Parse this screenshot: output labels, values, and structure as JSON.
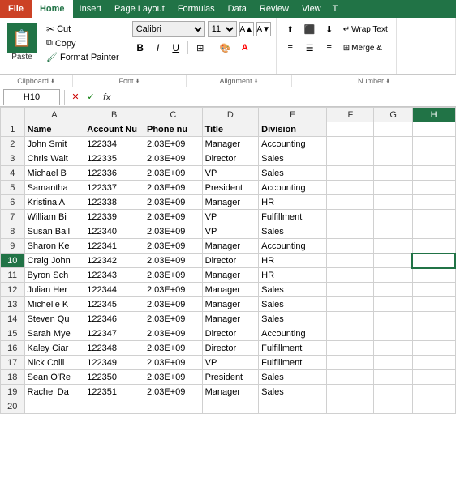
{
  "tabs": {
    "items": [
      "File",
      "Home",
      "Insert",
      "Page Layout",
      "Formulas",
      "Data",
      "Review",
      "View",
      "T"
    ]
  },
  "ribbon": {
    "clipboard": {
      "paste_label": "Paste",
      "cut_label": "Cut",
      "copy_label": "Copy",
      "format_painter_label": "Format Painter",
      "group_name": "Clipboard"
    },
    "font": {
      "font_name": "Calibri",
      "font_size": "11",
      "bold_label": "B",
      "italic_label": "I",
      "underline_label": "U",
      "border_label": "⊞",
      "fill_label": "A",
      "color_label": "A",
      "group_name": "Font"
    },
    "alignment": {
      "group_name": "Alignment",
      "wrap_text_label": "Wrap Text",
      "merge_label": "Merge &"
    }
  },
  "formula_bar": {
    "name_box": "H10",
    "formula_content": ""
  },
  "columns": {
    "row_header": "",
    "headers": [
      "A",
      "B",
      "C",
      "D",
      "E",
      "F",
      "G",
      "H"
    ],
    "col_labels": [
      "Name",
      "Account Nu",
      "Phone nu",
      "Title",
      "Division",
      "",
      "",
      ""
    ]
  },
  "rows": [
    {
      "num": 1,
      "a": "Name",
      "b": "Account Nu",
      "c": "Phone nu",
      "d": "Title",
      "e": "Division",
      "f": "",
      "g": "",
      "h": ""
    },
    {
      "num": 2,
      "a": "John Smit",
      "b": "122334",
      "c": "2.03E+09",
      "d": "Manager",
      "e": "Accounting",
      "f": "",
      "g": "",
      "h": ""
    },
    {
      "num": 3,
      "a": "Chris Walt",
      "b": "122335",
      "c": "2.03E+09",
      "d": "Director",
      "e": "Sales",
      "f": "",
      "g": "",
      "h": ""
    },
    {
      "num": 4,
      "a": "Michael B",
      "b": "122336",
      "c": "2.03E+09",
      "d": "VP",
      "e": "Sales",
      "f": "",
      "g": "",
      "h": ""
    },
    {
      "num": 5,
      "a": "Samantha",
      "b": "122337",
      "c": "2.03E+09",
      "d": "President",
      "e": "Accounting",
      "f": "",
      "g": "",
      "h": ""
    },
    {
      "num": 6,
      "a": "Kristina A",
      "b": "122338",
      "c": "2.03E+09",
      "d": "Manager",
      "e": "HR",
      "f": "",
      "g": "",
      "h": ""
    },
    {
      "num": 7,
      "a": "William Bi",
      "b": "122339",
      "c": "2.03E+09",
      "d": "VP",
      "e": "Fulfillment",
      "f": "",
      "g": "",
      "h": ""
    },
    {
      "num": 8,
      "a": "Susan Bail",
      "b": "122340",
      "c": "2.03E+09",
      "d": "VP",
      "e": "Sales",
      "f": "",
      "g": "",
      "h": ""
    },
    {
      "num": 9,
      "a": "Sharon Ke",
      "b": "122341",
      "c": "2.03E+09",
      "d": "Manager",
      "e": "Accounting",
      "f": "",
      "g": "",
      "h": ""
    },
    {
      "num": 10,
      "a": "Craig John",
      "b": "122342",
      "c": "2.03E+09",
      "d": "Director",
      "e": "HR",
      "f": "",
      "g": "",
      "h": ""
    },
    {
      "num": 11,
      "a": "Byron Sch",
      "b": "122343",
      "c": "2.03E+09",
      "d": "Manager",
      "e": "HR",
      "f": "",
      "g": "",
      "h": ""
    },
    {
      "num": 12,
      "a": "Julian Her",
      "b": "122344",
      "c": "2.03E+09",
      "d": "Manager",
      "e": "Sales",
      "f": "",
      "g": "",
      "h": ""
    },
    {
      "num": 13,
      "a": "Michelle K",
      "b": "122345",
      "c": "2.03E+09",
      "d": "Manager",
      "e": "Sales",
      "f": "",
      "g": "",
      "h": ""
    },
    {
      "num": 14,
      "a": "Steven Qu",
      "b": "122346",
      "c": "2.03E+09",
      "d": "Manager",
      "e": "Sales",
      "f": "",
      "g": "",
      "h": ""
    },
    {
      "num": 15,
      "a": "Sarah Mye",
      "b": "122347",
      "c": "2.03E+09",
      "d": "Director",
      "e": "Accounting",
      "f": "",
      "g": "",
      "h": ""
    },
    {
      "num": 16,
      "a": "Kaley Ciar",
      "b": "122348",
      "c": "2.03E+09",
      "d": "Director",
      "e": "Fulfillment",
      "f": "",
      "g": "",
      "h": ""
    },
    {
      "num": 17,
      "a": "Nick Colli",
      "b": "122349",
      "c": "2.03E+09",
      "d": "VP",
      "e": "Fulfillment",
      "f": "",
      "g": "",
      "h": ""
    },
    {
      "num": 18,
      "a": "Sean O'Re",
      "b": "122350",
      "c": "2.03E+09",
      "d": "President",
      "e": "Sales",
      "f": "",
      "g": "",
      "h": ""
    },
    {
      "num": 19,
      "a": "Rachel Da",
      "b": "122351",
      "c": "2.03E+09",
      "d": "Manager",
      "e": "Sales",
      "f": "",
      "g": "",
      "h": ""
    },
    {
      "num": 20,
      "a": "",
      "b": "",
      "c": "",
      "d": "",
      "e": "",
      "f": "",
      "g": "",
      "h": ""
    }
  ]
}
